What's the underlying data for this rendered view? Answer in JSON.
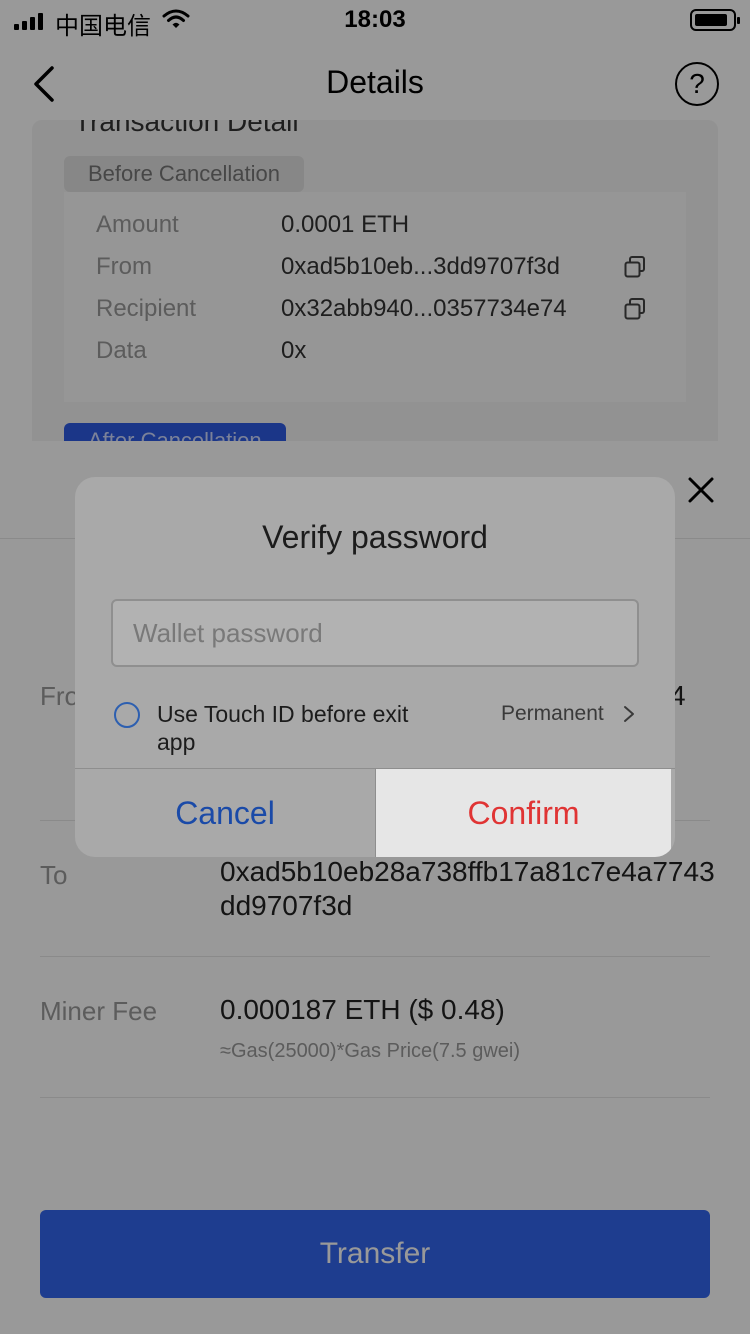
{
  "status_bar": {
    "carrier": "中国电信",
    "time": "18:03"
  },
  "nav": {
    "title": "Details",
    "help_glyph": "?"
  },
  "background_card": {
    "title": "Transaction Detail",
    "before_tag": "Before Cancellation",
    "rows": [
      {
        "key": "Amount",
        "value": "0.0001 ETH"
      },
      {
        "key": "From",
        "value": "0xad5b10eb...3dd9707f3d"
      },
      {
        "key": "Recipient",
        "value": "0x32abb940...0357734e74"
      },
      {
        "key": "Data",
        "value": "0x"
      }
    ],
    "after_tag": "After Cancellation"
  },
  "sheet": {
    "from_label": "From",
    "from_value_tail": "4",
    "to_label": "To",
    "to_value": "0xad5b10eb28a738ffb17a81c7e4a7743dd9707f3d",
    "fee_label": "Miner Fee",
    "fee_value": "0.000187 ETH ($ 0.48)",
    "fee_sub": "≈Gas(25000)*Gas Price(7.5 gwei)",
    "transfer_label": "Transfer"
  },
  "dialog": {
    "title": "Verify password",
    "password_placeholder": "Wallet password",
    "password_value": "",
    "touch_id_label": "Use Touch ID before exit app",
    "touch_id_checked": false,
    "duration_label": "Permanent",
    "cancel_label": "Cancel",
    "confirm_label": "Confirm"
  },
  "colors": {
    "accent_blue": "#3366ee",
    "confirm_red": "#e03434",
    "cancel_blue": "#1a4aa8"
  }
}
